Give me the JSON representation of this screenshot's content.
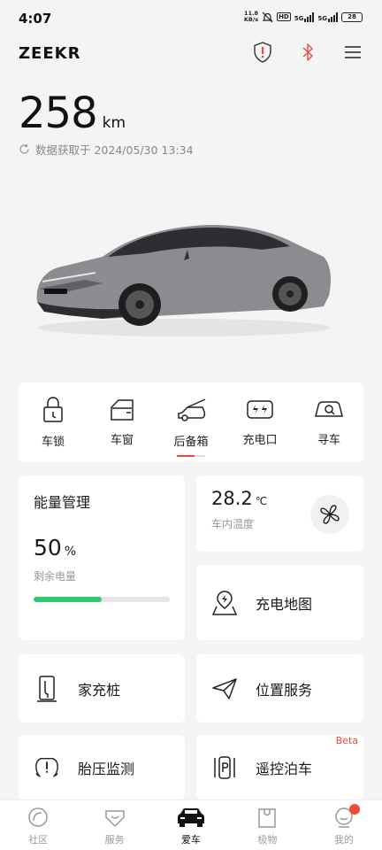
{
  "status_bar": {
    "time": "4:07",
    "net_speed_value": "11.8",
    "net_speed_unit": "KB/s",
    "hd": "HD",
    "sim1": "5G",
    "sim2": "5G",
    "battery": "28"
  },
  "header": {
    "brand": "ZEEKR",
    "icons": [
      "shield-alert-icon",
      "bluetooth-icon",
      "menu-icon"
    ]
  },
  "range": {
    "value": "258",
    "unit": "km",
    "data_time": "数据获取于 2024/05/30 13:34"
  },
  "quick_controls": {
    "items": [
      {
        "label": "车锁",
        "icon": "lock-icon"
      },
      {
        "label": "车窗",
        "icon": "window-icon"
      },
      {
        "label": "后备箱",
        "icon": "trunk-icon"
      },
      {
        "label": "充电口",
        "icon": "charge-port-icon"
      },
      {
        "label": "寻车",
        "icon": "find-car-icon"
      }
    ]
  },
  "energy": {
    "title": "能量管理",
    "percent_value": "50",
    "percent_symbol": "%",
    "subtitle": "剩余电量",
    "level": 0.5
  },
  "temperature": {
    "value": "28.2",
    "unit": "℃",
    "subtitle": "车内温度"
  },
  "tiles": {
    "charging_map": "充电地图",
    "home_charger": "家充桩",
    "location_service": "位置服务",
    "tire_pressure": "胎压监测",
    "remote_parking": "遥控泊车",
    "beta": "Beta"
  },
  "tabbar": {
    "items": [
      {
        "label": "社区",
        "icon": "community-icon"
      },
      {
        "label": "服务",
        "icon": "service-icon"
      },
      {
        "label": "爱车",
        "icon": "car-icon",
        "active": true
      },
      {
        "label": "极物",
        "icon": "shop-icon"
      },
      {
        "label": "我的",
        "icon": "profile-icon"
      }
    ]
  },
  "colors": {
    "accent_red": "#e84c3d",
    "battery_green": "#2ecc71"
  }
}
